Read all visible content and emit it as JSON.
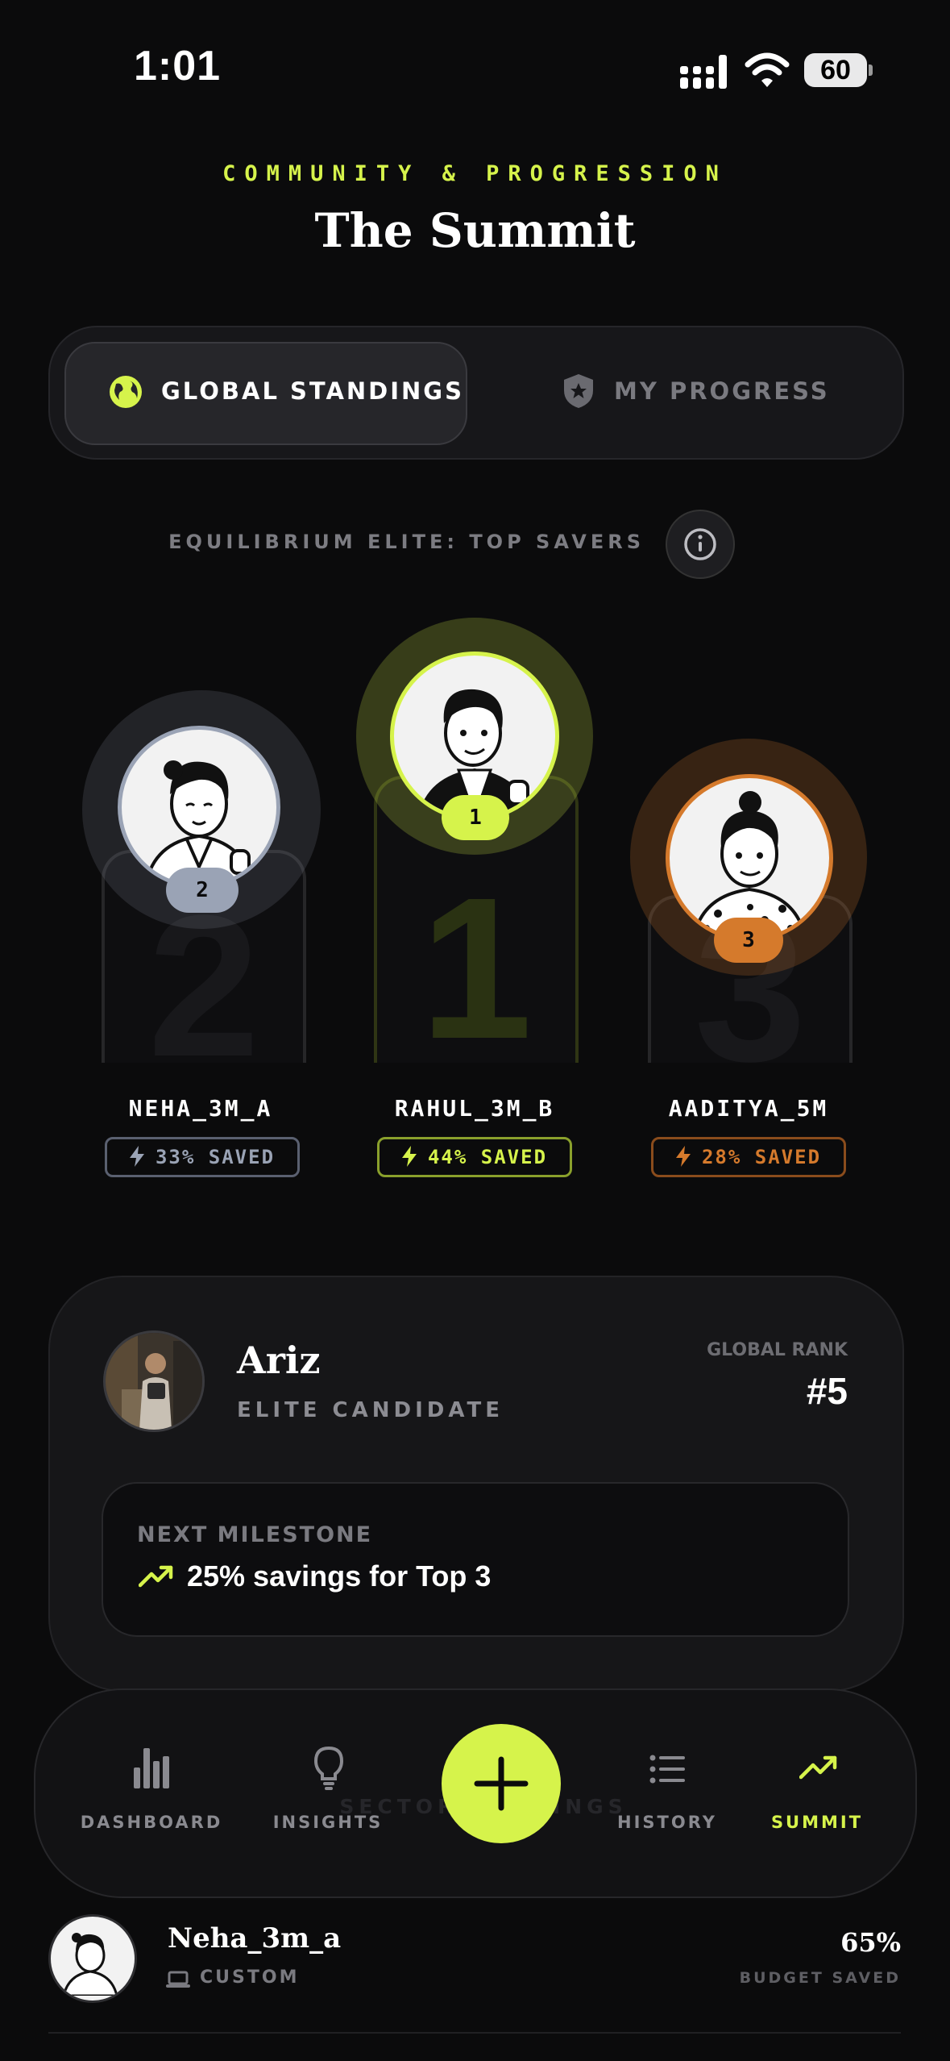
{
  "status_bar": {
    "time": "1:01",
    "battery": "60"
  },
  "header": {
    "eyebrow": "COMMUNITY & PROGRESSION",
    "title": "The Summit"
  },
  "tabs": [
    {
      "label": "GLOBAL STANDINGS",
      "icon": "globe-icon",
      "active": true
    },
    {
      "label": "MY PROGRESS",
      "icon": "shield-star-icon",
      "active": false
    }
  ],
  "leaderboard": {
    "subtitle": "EQUILIBRIUM ELITE: TOP SAVERS",
    "podium": [
      {
        "rank": "2",
        "name": "NEHA_3M_A",
        "saved": "33% SAVED",
        "color": "#9aa3b5"
      },
      {
        "rank": "1",
        "name": "RAHUL_3M_B",
        "saved": "44% SAVED",
        "color": "#d6f34b"
      },
      {
        "rank": "3",
        "name": "AADITYA_5M",
        "saved": "28% SAVED",
        "color": "#d57a2c"
      }
    ]
  },
  "user_card": {
    "name": "Ariz",
    "tier": "ELITE CANDIDATE",
    "rank_label": "GLOBAL RANK",
    "rank": "#5",
    "milestone_label": "NEXT MILESTONE",
    "milestone_text": "25% savings for Top 3"
  },
  "nav": {
    "items": [
      {
        "label": "DASHBOARD",
        "icon": "bar-chart-icon"
      },
      {
        "label": "INSIGHTS",
        "icon": "lightbulb-icon"
      },
      {
        "label": "HISTORY",
        "icon": "list-icon"
      },
      {
        "label": "SUMMIT",
        "icon": "trending-up-icon",
        "active": true
      }
    ],
    "add_icon": "plus-icon",
    "ghost_text": "SECTOR RANKINGS"
  },
  "list_row": {
    "name": "Neha_3m_a",
    "sub": "CUSTOM",
    "percent": "65%",
    "percent_label": "BUDGET SAVED"
  },
  "colors": {
    "accent": "#d6f34b",
    "silver": "#9aa3b5",
    "bronze": "#d57a2c",
    "background": "#0b0b0c"
  }
}
